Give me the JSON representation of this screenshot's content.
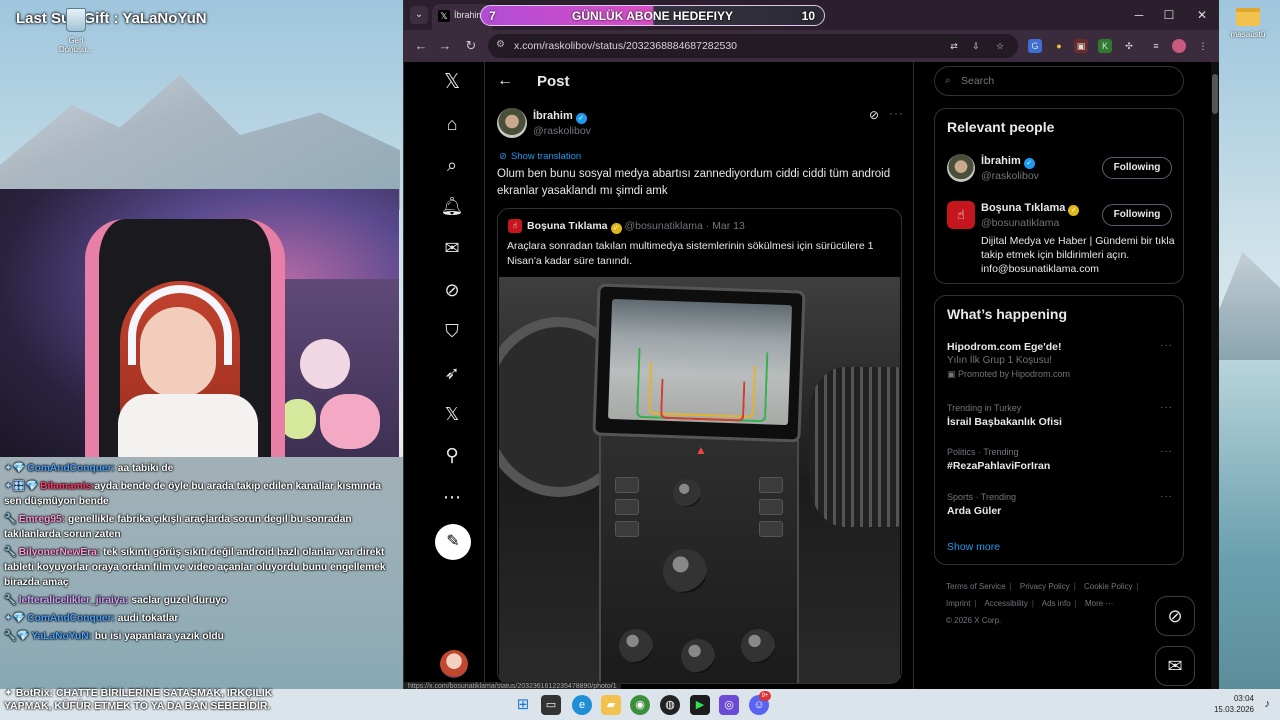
{
  "desktop": {
    "overlay_title": "Last Sub Gift : YaLaNoYuN",
    "recycle_label": "Geri Dönüşü...",
    "folder_label": "masaüstü"
  },
  "chat": {
    "messages": [
      {
        "user": "ComAndConquer:",
        "text": "aa tabiki de",
        "user_color": "#4aa3ff",
        "badge": "✦💎"
      },
      {
        "user": "Bilamamis:",
        "text": "ayda bende de öyle bu arada takip edilen kanallar kısmında sen düşmüyon bende",
        "user_color": "#ff3b6b",
        "badge": "✦🎛💎"
      },
      {
        "user": "Emreg95:",
        "text": "genellikle fabrika çıkışlı araçlarda sorun degil bu sonradan takılanlarda sorun zaten",
        "user_color": "#ff9ad5",
        "badge": "🔧"
      },
      {
        "user": "BilyonerNewEra:",
        "text": "tek sıkıntı görüş sıkıtı değil android bazlı olanlar var direkt tableti koyuyorlar oraya ordan film ve video açanlar oluyordu bunu engellemek birazda amaç",
        "user_color": "#ff9ad5",
        "badge": "🔧"
      },
      {
        "user": "lefteralicelikler_jiraiya:",
        "text": "saclar guzel duruyo",
        "user_color": "#d7a6ff",
        "badge": "🔧"
      },
      {
        "user": "ComAndConquer:",
        "text": "audi tokatlar",
        "user_color": "#4aa3ff",
        "badge": "✦💎"
      },
      {
        "user": "YaLaNoYuN:",
        "text": "bu isi yapanlara yazık oldu",
        "user_color": "#4aa3ff",
        "badge": "🔧💎"
      }
    ],
    "bottom_notice": "✦ BotRix: CHATTE BİRİLERİNE SATAŞMAK, IRKÇILIK YAPMAK, KÜFÜR ETMEK TO YA DA BAN SEBEBİDİR."
  },
  "browser": {
    "tab_title": "İbrahim",
    "address": "x.com/raskolibov/status/2032368884687282530",
    "status_url": "https://x.com/bosunatiklama/status/2032361612235478890/photo/1"
  },
  "sub_goal": {
    "current": "7",
    "label": "GÜNLÜK ABONE HEDEFIYY",
    "target": "10",
    "progress": 0.7
  },
  "post": {
    "header_title": "Post",
    "author_name": "İbrahim",
    "author_handle": "@raskolibov",
    "show_translation": "Show translation",
    "text": "Olum ben bunu sosyal medya abartısı zannediyordum ciddi ciddi tüm android ekranlar yasaklandı mı şimdi amk",
    "quote": {
      "name": "Boşuna Tıklama",
      "handle_date": "@bosunatiklama · Mar 13",
      "text": "Araçlara sonradan takılan multimedya sistemlerinin sökülmesi için sürücülere 1 Nisan'a kadar süre tanındı."
    }
  },
  "sidebar": {
    "search_placeholder": "Search",
    "relevant_title": "Relevant people",
    "people": [
      {
        "name": "İbrahim",
        "handle": "@raskolibov",
        "button": "Following"
      },
      {
        "name": "Boşuna Tıklama",
        "handle": "@bosunatiklama",
        "button": "Following",
        "bio": "Dijital Medya ve Haber | Gündemi bir tıkla takip etmek için bildirimleri açın. info@bosunatiklama.com"
      }
    ],
    "happening_title": "What’s happening",
    "trends": [
      {
        "meta": "",
        "name": "Hipodrom.com Ege'de!",
        "sub": "Yılın İlk Grup 1 Koşusu!",
        "promo": "Promoted by Hipodrom.com"
      },
      {
        "meta": "Trending in Turkey",
        "name": "İsrail Başbakanlık Ofisi"
      },
      {
        "meta": "Politics · Trending",
        "name": "#RezaPahlaviForIran"
      },
      {
        "meta": "Sports · Trending",
        "name": "Arda Güler"
      }
    ],
    "show_more": "Show more",
    "footer": {
      "terms": "Terms of Service",
      "privacy": "Privacy Policy",
      "cookie": "Cookie Policy",
      "imprint": "Imprint",
      "accessibility": "Accessibility",
      "ads": "Ads info",
      "more": "More ···",
      "copyright": "© 2026 X Corp."
    }
  },
  "taskbar": {
    "time": "03:04",
    "date": "15.03.2026",
    "badge_count": "9+"
  },
  "icons": {
    "x_logo": "𝕏",
    "home": "⌂",
    "search": "⌕",
    "bell": "♫",
    "mail": "✉",
    "grok": "⊘",
    "bookmark": "⚑",
    "rocket": "➶",
    "profile": "☺",
    "more": "⋯",
    "post": "✎"
  },
  "colors": {
    "x_blue": "#1d9bf0",
    "verified_gold": "#e2b719",
    "bg": "#000000",
    "border": "#2f3336"
  }
}
